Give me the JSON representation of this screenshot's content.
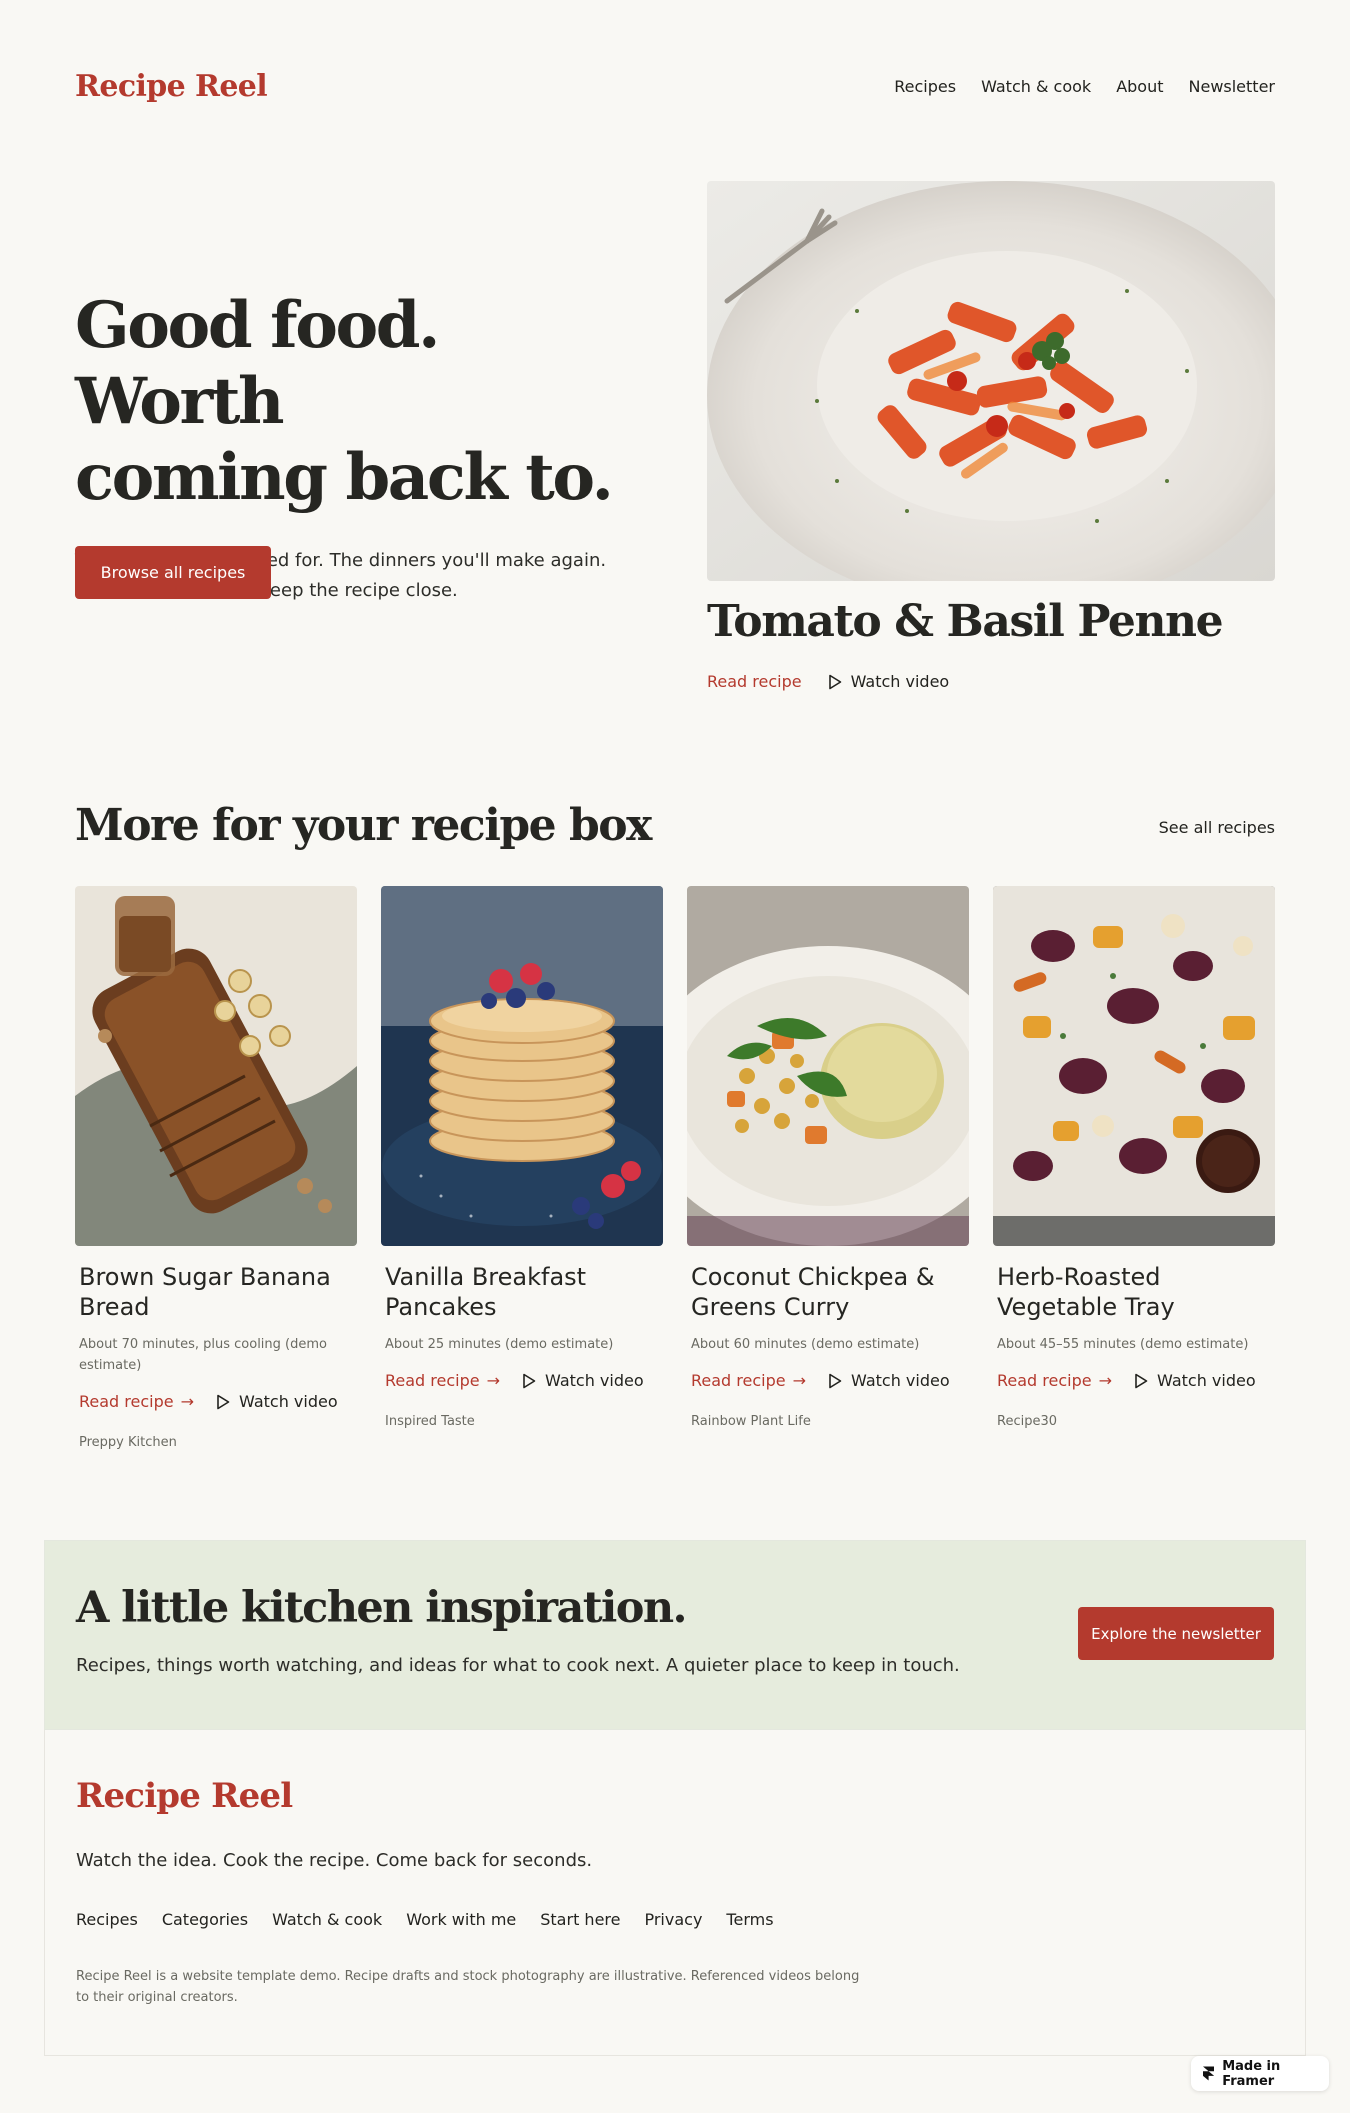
{
  "header": {
    "logo": "Recipe Reel",
    "nav": [
      "Recipes",
      "Watch & cook",
      "About",
      "Newsletter"
    ]
  },
  "hero": {
    "title_line1": "Good food. Worth",
    "title_line2": "coming back to.",
    "subtitle": "The recipes you paused for. The dinners you'll make again. Find the video, then keep the recipe close.",
    "button": "Browse all recipes",
    "feature": {
      "title": "Tomato & Basil Penne",
      "read_label": "Read recipe",
      "watch_label": "Watch video"
    }
  },
  "recipe_box": {
    "title": "More for your recipe box",
    "see_all": "See all recipes",
    "cards": [
      {
        "title": "Brown Sugar Banana Bread",
        "time": "About 70 minutes, plus cooling (demo estimate)",
        "read": "Read recipe",
        "watch": "Watch video",
        "source": "Preppy Kitchen"
      },
      {
        "title": "Vanilla Breakfast Pancakes",
        "time": "About 25 minutes (demo estimate)",
        "read": "Read recipe",
        "watch": "Watch video",
        "source": "Inspired Taste"
      },
      {
        "title": "Coconut Chickpea & Greens Curry",
        "time": "About 60 minutes (demo estimate)",
        "read": "Read recipe",
        "watch": "Watch video",
        "source": "Rainbow Plant Life"
      },
      {
        "title": "Herb-Roasted Vegetable Tray",
        "time": "About 45–55 minutes (demo estimate)",
        "read": "Read recipe",
        "watch": "Watch video",
        "source": "Recipe30"
      }
    ]
  },
  "newsletter": {
    "title": "A little kitchen inspiration.",
    "subtitle": "Recipes, things worth watching, and ideas for what to cook next. A quieter place to keep in touch.",
    "button": "Explore the newsletter"
  },
  "footer": {
    "logo": "Recipe Reel",
    "tagline": "Watch the idea. Cook the recipe. Come back for seconds.",
    "nav": [
      "Recipes",
      "Categories",
      "Watch & cook",
      "Work with me",
      "Start here",
      "Privacy",
      "Terms"
    ],
    "note": "Recipe Reel is a website template demo. Recipe drafts and stock photography are illustrative. Referenced videos belong to their original creators."
  },
  "badge": "Made in Framer",
  "colors": {
    "accent": "#b43a2e",
    "background": "#f9f8f4",
    "band": "#e6ecdd",
    "text": "#23231f",
    "muted": "#6a6a62"
  }
}
